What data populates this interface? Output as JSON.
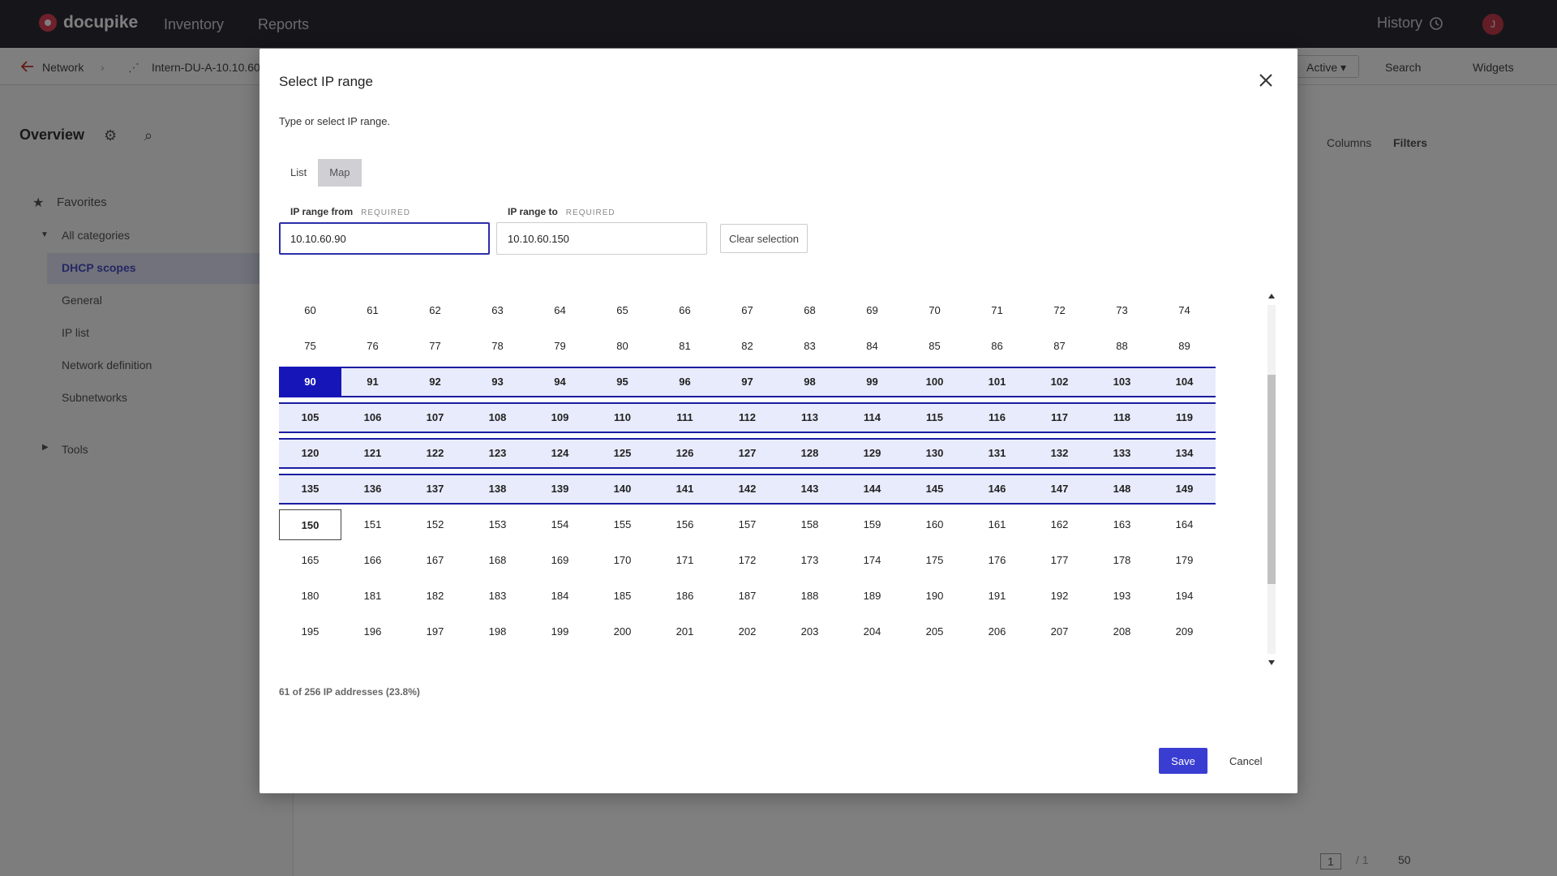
{
  "app": {
    "brand": "docupike",
    "nav": [
      "Inventory",
      "Reports"
    ],
    "history_label": "History",
    "avatar_initial": "J"
  },
  "subbar": {
    "back_label": "Network",
    "object_label": "Intern-DU-A-10.10.60",
    "status_label": "Active",
    "search_label": "Search",
    "widgets_label": "Widgets"
  },
  "sidebar": {
    "title": "Overview",
    "favorites": "Favorites",
    "all_categories": "All categories",
    "items": [
      "DHCP scopes",
      "General",
      "IP list",
      "Network definition",
      "Subnetworks"
    ],
    "selected_index": 0,
    "tools": "Tools"
  },
  "main": {
    "columns_label": "Columns",
    "filters_label": "Filters",
    "page_value": "1",
    "page_total": "/ 1",
    "per_page": "50"
  },
  "modal": {
    "title": "Select IP range",
    "subtitle": "Type or select IP range.",
    "tabs": [
      "List",
      "Map"
    ],
    "active_tab": 1,
    "from_label": "IP range from",
    "to_label": "IP range to",
    "required_tag": "REQUIRED",
    "from_value": "10.10.60.90",
    "to_value": "10.10.60.150",
    "clear_label": "Clear selection",
    "range_start": 90,
    "range_end": 150,
    "grid_first": 60,
    "grid_last": 209,
    "columns": 15,
    "summary": "61 of 256 IP addresses (23.8%)",
    "save_label": "Save",
    "cancel_label": "Cancel"
  }
}
